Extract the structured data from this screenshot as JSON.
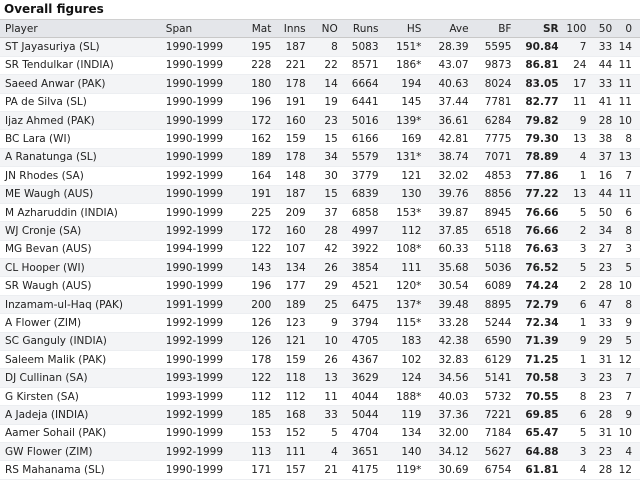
{
  "caption": "Overall figures",
  "headers": {
    "player": "Player",
    "span": "Span",
    "mat": "Mat",
    "inns": "Inns",
    "no": "NO",
    "runs": "Runs",
    "hs": "HS",
    "ave": "Ave",
    "bf": "BF",
    "sr": "SR",
    "hundreds": "100",
    "fifties": "50",
    "ducks": "0"
  },
  "rows": [
    {
      "player": "ST Jayasuriya (SL)",
      "span": "1990-1999",
      "mat": "195",
      "inns": "187",
      "no": "8",
      "runs": "5083",
      "hs": "151*",
      "ave": "28.39",
      "bf": "5595",
      "sr": "90.84",
      "hundreds": "7",
      "fifties": "33",
      "ducks": "14"
    },
    {
      "player": "SR Tendulkar (INDIA)",
      "span": "1990-1999",
      "mat": "228",
      "inns": "221",
      "no": "22",
      "runs": "8571",
      "hs": "186*",
      "ave": "43.07",
      "bf": "9873",
      "sr": "86.81",
      "hundreds": "24",
      "fifties": "44",
      "ducks": "11"
    },
    {
      "player": "Saeed Anwar (PAK)",
      "span": "1990-1999",
      "mat": "180",
      "inns": "178",
      "no": "14",
      "runs": "6664",
      "hs": "194",
      "ave": "40.63",
      "bf": "8024",
      "sr": "83.05",
      "hundreds": "17",
      "fifties": "33",
      "ducks": "11"
    },
    {
      "player": "PA de Silva (SL)",
      "span": "1990-1999",
      "mat": "196",
      "inns": "191",
      "no": "19",
      "runs": "6441",
      "hs": "145",
      "ave": "37.44",
      "bf": "7781",
      "sr": "82.77",
      "hundreds": "11",
      "fifties": "41",
      "ducks": "11"
    },
    {
      "player": "Ijaz Ahmed (PAK)",
      "span": "1990-1999",
      "mat": "172",
      "inns": "160",
      "no": "23",
      "runs": "5016",
      "hs": "139*",
      "ave": "36.61",
      "bf": "6284",
      "sr": "79.82",
      "hundreds": "9",
      "fifties": "28",
      "ducks": "10"
    },
    {
      "player": "BC Lara (WI)",
      "span": "1990-1999",
      "mat": "162",
      "inns": "159",
      "no": "15",
      "runs": "6166",
      "hs": "169",
      "ave": "42.81",
      "bf": "7775",
      "sr": "79.30",
      "hundreds": "13",
      "fifties": "38",
      "ducks": "8"
    },
    {
      "player": "A Ranatunga (SL)",
      "span": "1990-1999",
      "mat": "189",
      "inns": "178",
      "no": "34",
      "runs": "5579",
      "hs": "131*",
      "ave": "38.74",
      "bf": "7071",
      "sr": "78.89",
      "hundreds": "4",
      "fifties": "37",
      "ducks": "13"
    },
    {
      "player": "JN Rhodes (SA)",
      "span": "1992-1999",
      "mat": "164",
      "inns": "148",
      "no": "30",
      "runs": "3779",
      "hs": "121",
      "ave": "32.02",
      "bf": "4853",
      "sr": "77.86",
      "hundreds": "1",
      "fifties": "16",
      "ducks": "7"
    },
    {
      "player": "ME Waugh (AUS)",
      "span": "1990-1999",
      "mat": "191",
      "inns": "187",
      "no": "15",
      "runs": "6839",
      "hs": "130",
      "ave": "39.76",
      "bf": "8856",
      "sr": "77.22",
      "hundreds": "13",
      "fifties": "44",
      "ducks": "11"
    },
    {
      "player": "M Azharuddin (INDIA)",
      "span": "1990-1999",
      "mat": "225",
      "inns": "209",
      "no": "37",
      "runs": "6858",
      "hs": "153*",
      "ave": "39.87",
      "bf": "8945",
      "sr": "76.66",
      "hundreds": "5",
      "fifties": "50",
      "ducks": "6"
    },
    {
      "player": "WJ Cronje (SA)",
      "span": "1992-1999",
      "mat": "172",
      "inns": "160",
      "no": "28",
      "runs": "4997",
      "hs": "112",
      "ave": "37.85",
      "bf": "6518",
      "sr": "76.66",
      "hundreds": "2",
      "fifties": "34",
      "ducks": "8"
    },
    {
      "player": "MG Bevan (AUS)",
      "span": "1994-1999",
      "mat": "122",
      "inns": "107",
      "no": "42",
      "runs": "3922",
      "hs": "108*",
      "ave": "60.33",
      "bf": "5118",
      "sr": "76.63",
      "hundreds": "3",
      "fifties": "27",
      "ducks": "3"
    },
    {
      "player": "CL Hooper (WI)",
      "span": "1990-1999",
      "mat": "143",
      "inns": "134",
      "no": "26",
      "runs": "3854",
      "hs": "111",
      "ave": "35.68",
      "bf": "5036",
      "sr": "76.52",
      "hundreds": "5",
      "fifties": "23",
      "ducks": "5"
    },
    {
      "player": "SR Waugh (AUS)",
      "span": "1990-1999",
      "mat": "196",
      "inns": "177",
      "no": "29",
      "runs": "4521",
      "hs": "120*",
      "ave": "30.54",
      "bf": "6089",
      "sr": "74.24",
      "hundreds": "2",
      "fifties": "28",
      "ducks": "10"
    },
    {
      "player": "Inzamam-ul-Haq (PAK)",
      "span": "1991-1999",
      "mat": "200",
      "inns": "189",
      "no": "25",
      "runs": "6475",
      "hs": "137*",
      "ave": "39.48",
      "bf": "8895",
      "sr": "72.79",
      "hundreds": "6",
      "fifties": "47",
      "ducks": "8"
    },
    {
      "player": "A Flower (ZIM)",
      "span": "1992-1999",
      "mat": "126",
      "inns": "123",
      "no": "9",
      "runs": "3794",
      "hs": "115*",
      "ave": "33.28",
      "bf": "5244",
      "sr": "72.34",
      "hundreds": "1",
      "fifties": "33",
      "ducks": "9"
    },
    {
      "player": "SC Ganguly (INDIA)",
      "span": "1992-1999",
      "mat": "126",
      "inns": "121",
      "no": "10",
      "runs": "4705",
      "hs": "183",
      "ave": "42.38",
      "bf": "6590",
      "sr": "71.39",
      "hundreds": "9",
      "fifties": "29",
      "ducks": "5"
    },
    {
      "player": "Saleem Malik (PAK)",
      "span": "1990-1999",
      "mat": "178",
      "inns": "159",
      "no": "26",
      "runs": "4367",
      "hs": "102",
      "ave": "32.83",
      "bf": "6129",
      "sr": "71.25",
      "hundreds": "1",
      "fifties": "31",
      "ducks": "12"
    },
    {
      "player": "DJ Cullinan (SA)",
      "span": "1993-1999",
      "mat": "122",
      "inns": "118",
      "no": "13",
      "runs": "3629",
      "hs": "124",
      "ave": "34.56",
      "bf": "5141",
      "sr": "70.58",
      "hundreds": "3",
      "fifties": "23",
      "ducks": "7"
    },
    {
      "player": "G Kirsten (SA)",
      "span": "1993-1999",
      "mat": "112",
      "inns": "112",
      "no": "11",
      "runs": "4044",
      "hs": "188*",
      "ave": "40.03",
      "bf": "5732",
      "sr": "70.55",
      "hundreds": "8",
      "fifties": "23",
      "ducks": "7"
    },
    {
      "player": "A Jadeja (INDIA)",
      "span": "1992-1999",
      "mat": "185",
      "inns": "168",
      "no": "33",
      "runs": "5044",
      "hs": "119",
      "ave": "37.36",
      "bf": "7221",
      "sr": "69.85",
      "hundreds": "6",
      "fifties": "28",
      "ducks": "9"
    },
    {
      "player": "Aamer Sohail (PAK)",
      "span": "1990-1999",
      "mat": "153",
      "inns": "152",
      "no": "5",
      "runs": "4704",
      "hs": "134",
      "ave": "32.00",
      "bf": "7184",
      "sr": "65.47",
      "hundreds": "5",
      "fifties": "31",
      "ducks": "10"
    },
    {
      "player": "GW Flower (ZIM)",
      "span": "1992-1999",
      "mat": "113",
      "inns": "111",
      "no": "4",
      "runs": "3651",
      "hs": "140",
      "ave": "34.12",
      "bf": "5627",
      "sr": "64.88",
      "hundreds": "3",
      "fifties": "23",
      "ducks": "4"
    },
    {
      "player": "RS Mahanama (SL)",
      "span": "1990-1999",
      "mat": "171",
      "inns": "157",
      "no": "21",
      "runs": "4175",
      "hs": "119*",
      "ave": "30.69",
      "bf": "6754",
      "sr": "61.81",
      "hundreds": "4",
      "fifties": "28",
      "ducks": "12"
    }
  ]
}
